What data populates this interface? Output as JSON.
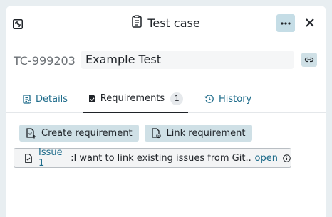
{
  "header": {
    "title": "Test case",
    "more_label": "···",
    "close_label": "✕"
  },
  "testcase": {
    "id": "TC-999203",
    "name": "Example Test"
  },
  "tabs": {
    "details": "Details",
    "requirements": "Requirements",
    "requirements_count": "1",
    "history": "History"
  },
  "actions": {
    "create": "Create requirement",
    "link": "Link requirement"
  },
  "issue": {
    "ref": "Issue 1",
    "separator": ":",
    "title": " I want to link existing issues from Git...",
    "state": "open"
  },
  "colors": {
    "accent": "#1d6b8a",
    "button_bg": "#cfe0e6",
    "background": "#e8eef1"
  }
}
